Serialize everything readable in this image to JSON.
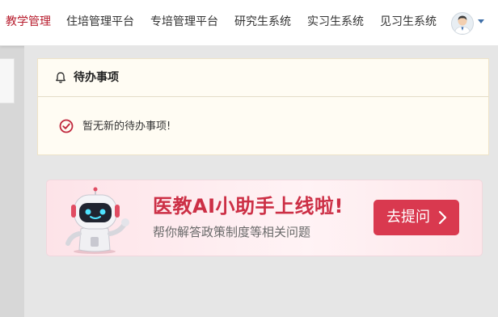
{
  "nav": {
    "items": [
      {
        "label": "教学管理",
        "active": true
      },
      {
        "label": "住培管理平台",
        "active": false
      },
      {
        "label": "专培管理平台",
        "active": false
      },
      {
        "label": "研究生系统",
        "active": false
      },
      {
        "label": "实习生系统",
        "active": false
      },
      {
        "label": "见习生系统",
        "active": false
      }
    ],
    "avatar_icon": "user-avatar-icon",
    "menu_icon": "caret-down-icon"
  },
  "todo": {
    "icon": "bell-icon",
    "title": "待办事项",
    "empty_icon": "check-circle-icon",
    "empty_message": "暂无新的待办事项!"
  },
  "ai_banner": {
    "title": "医教AI小助手上线啦!",
    "subtitle": "帮你解答政策制度等相关问题",
    "button_label": "去提问",
    "button_icon": "chevron-right-icon"
  },
  "colors": {
    "brand_red": "#b71c2d",
    "banner_title": "#cc2f45",
    "button_bg": "#d9394f",
    "todo_bg": "#fffcf3"
  }
}
